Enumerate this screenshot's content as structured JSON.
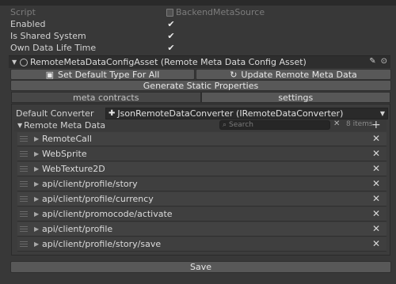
{
  "fields": {
    "script_label": "Script",
    "script_value": "BackendMetaSource",
    "enabled_label": "Enabled",
    "enabled_checked": true,
    "shared_label": "Is Shared System",
    "shared_checked": true,
    "lifetime_label": "Own Data Life Time",
    "lifetime_checked": true,
    "check_glyph": "✔"
  },
  "asset": {
    "title": "RemoteMetaDataConfigAsset (Remote Meta Data Config Asset)"
  },
  "buttons": {
    "set_default": "Set Default Type For All",
    "update_remote": "Update Remote Meta Data",
    "generate": "Generate Static Properties",
    "save": "Save"
  },
  "tabs": [
    {
      "label": "meta contracts",
      "active": true
    },
    {
      "label": "settings",
      "active": false
    }
  ],
  "converter": {
    "label": "Default Converter",
    "value": "JsonRemoteDataConverter (IRemoteDataConverter)"
  },
  "list": {
    "title": "Remote Meta Data",
    "search_placeholder": "Search",
    "count": "8 items",
    "items": [
      "RemoteCall",
      "WebSprite",
      "WebTexture2D",
      "api/client/profile/story",
      "api/client/profile/currency",
      "api/client/promocode/activate",
      "api/client/profile",
      "api/client/profile/story/save"
    ]
  },
  "colors": {
    "background": "#383838",
    "button": "#585858",
    "field": "#2a2a2a",
    "text": "#d2d2d2",
    "disabled_text": "#7c7c7c"
  },
  "icons": {
    "asset": "script-icon",
    "set_default": "image-icon",
    "update": "refresh-icon",
    "converter": "puzzle-icon",
    "edit": "pencil-icon",
    "settings": "gear-icon",
    "remove": "close-icon",
    "add": "plus-icon"
  }
}
